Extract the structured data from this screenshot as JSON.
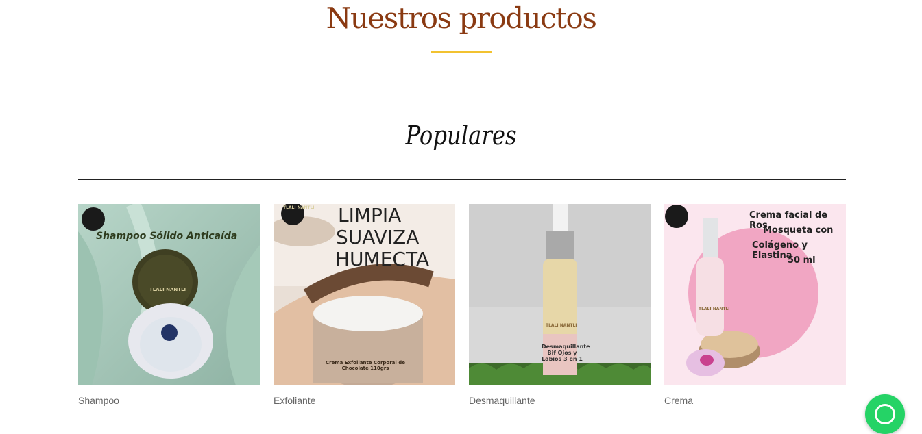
{
  "section": {
    "title": "Nuestros productos",
    "subtitle": "Populares"
  },
  "products": [
    {
      "category": "Shampoo",
      "image_text": "Shampoo Sólido Anticaída",
      "label_text": "TLALI NANTLI"
    },
    {
      "category": "Exfoliante",
      "image_lines": [
        "LIMPIA",
        "SUAVIZA",
        "HUMECTA"
      ],
      "jar_text": "Crema Exfoliante Corporal de Chocolate 110grs",
      "label_text": "TLALI NANTLI"
    },
    {
      "category": "Desmaquillante",
      "bottle_text": "Desmaquillante Bif Ojos y Labios 3 en 1",
      "label_text": "TLALI NANTLI"
    },
    {
      "category": "Crema",
      "image_lines": [
        "Crema facial de Ros",
        "Mosqueta con",
        "Colágeno y Elastina",
        "50 ml"
      ],
      "label_text": "TLALI NANTLI"
    }
  ],
  "icons": {
    "whatsapp": "whatsapp-icon"
  },
  "colors": {
    "title": "#8a3a12",
    "accent_underline": "#f2c230",
    "whatsapp": "#25d366"
  }
}
